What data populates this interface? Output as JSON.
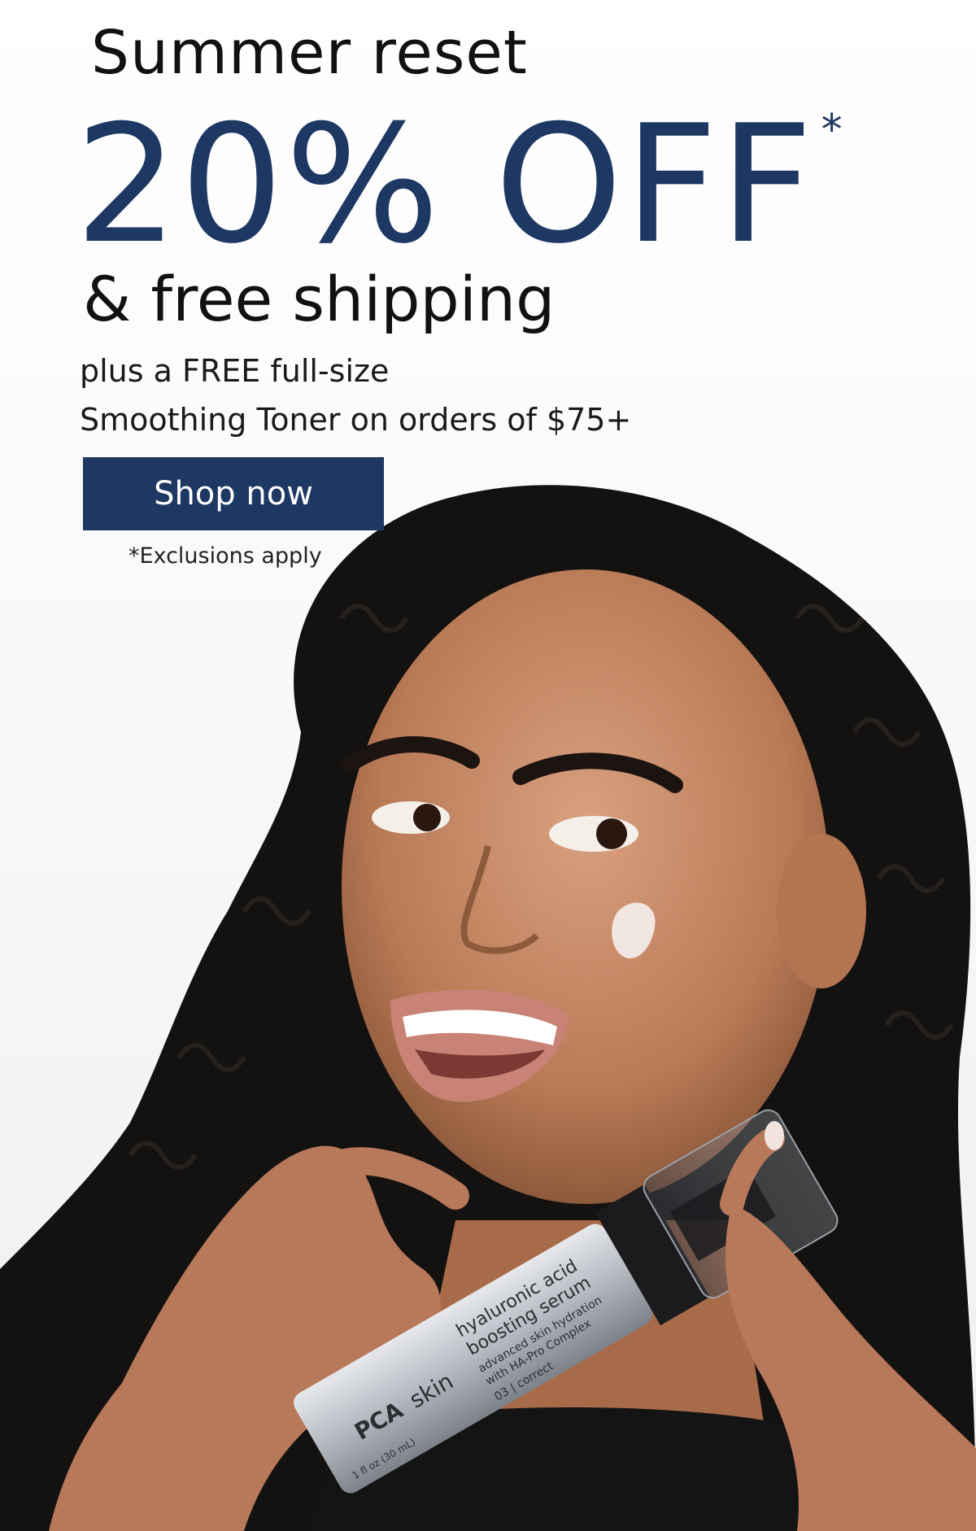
{
  "promo": {
    "headline_small": "Summer reset",
    "headline_big": "20% OFF",
    "asterisk": "*",
    "headline_sub": "& free shipping",
    "offer_line_1": "plus a FREE full-size",
    "offer_line_2": "Smoothing Toner on orders of $75+",
    "cta_label": "Shop now",
    "disclaimer": "*Exclusions apply"
  },
  "product": {
    "brand_mark": "PCA",
    "brand_word": "skin",
    "name_line_1": "hyaluronic acid",
    "name_line_2": "boosting serum",
    "desc_line_1": "advanced skin hydration",
    "desc_line_2": "with HA-Pro Complex",
    "step": "03 | correct",
    "size": "1 fl oz (30 mL)"
  },
  "colors": {
    "brand_navy": "#1e3864",
    "text_dark": "#111111",
    "background": "#ffffff"
  }
}
